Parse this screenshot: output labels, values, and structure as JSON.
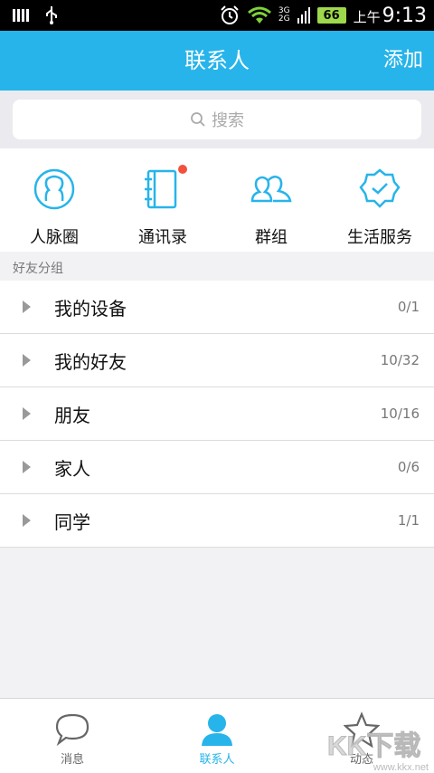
{
  "status_bar": {
    "ampm": "上午",
    "time": "9:13",
    "battery": "66",
    "net_top": "3G",
    "net_bottom": "2G"
  },
  "header": {
    "title": "联系人",
    "add_label": "添加"
  },
  "search": {
    "placeholder": "搜索"
  },
  "quick_actions": [
    {
      "label": "人脉圈",
      "icon": "contacts-circle-icon"
    },
    {
      "label": "通讯录",
      "icon": "address-book-icon",
      "badge": true
    },
    {
      "label": "群组",
      "icon": "group-icon"
    },
    {
      "label": "生活服务",
      "icon": "life-service-icon"
    }
  ],
  "section": {
    "label": "好友分组"
  },
  "groups": [
    {
      "name": "我的设备",
      "count": "0/1"
    },
    {
      "name": "我的好友",
      "count": "10/32"
    },
    {
      "name": "朋友",
      "count": "10/16"
    },
    {
      "name": "家人",
      "count": "0/6"
    },
    {
      "name": "同学",
      "count": "1/1"
    }
  ],
  "bottom_nav": [
    {
      "label": "消息",
      "icon": "message-bubble-icon"
    },
    {
      "label": "联系人",
      "icon": "contact-person-icon",
      "active": true
    },
    {
      "label": "动态",
      "icon": "star-icon"
    }
  ],
  "watermark": {
    "text": "www.kkx.net",
    "logo_text": "KK下载"
  },
  "colors": {
    "primary": "#27b4ea",
    "badge": "#f2523d",
    "battery": "#9ed84c"
  }
}
